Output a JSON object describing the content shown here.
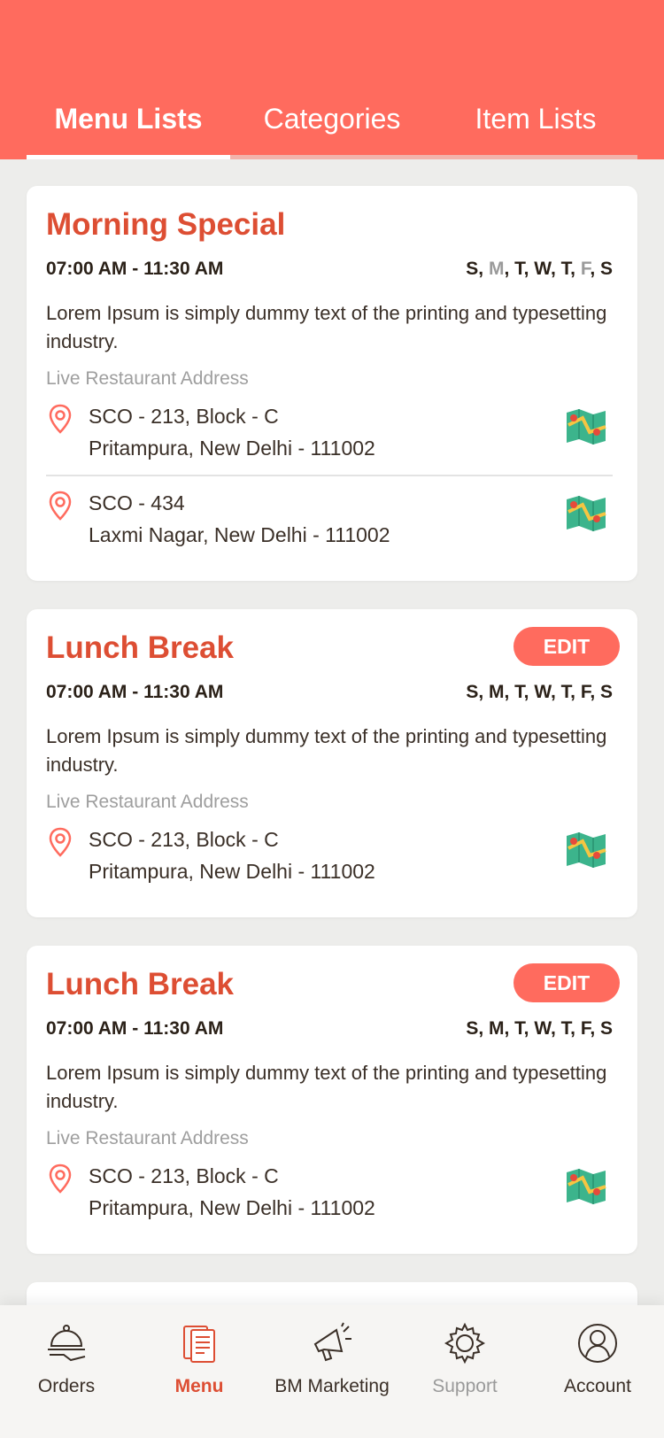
{
  "tabs": [
    {
      "label": "Menu Lists"
    },
    {
      "label": "Categories"
    },
    {
      "label": "Item Lists"
    }
  ],
  "cards": [
    {
      "title": "Morning Special",
      "time": "07:00 AM - 11:30 AM",
      "days": [
        {
          "d": "S",
          "on": true
        },
        {
          "d": "M",
          "on": false
        },
        {
          "d": "T",
          "on": true
        },
        {
          "d": "W",
          "on": true
        },
        {
          "d": "T",
          "on": true
        },
        {
          "d": "F",
          "on": false
        },
        {
          "d": "S",
          "on": true
        }
      ],
      "description": "Lorem Ipsum is simply dummy text of the printing and typesetting industry.",
      "address_label": "Live Restaurant Address",
      "addresses": [
        {
          "line1": "SCO - 213, Block - C",
          "line2": "Pritampura,  New Delhi - 111002"
        },
        {
          "line1": "SCO - 434",
          "line2": "Laxmi Nagar,  New Delhi - 111002"
        }
      ]
    },
    {
      "title": "Lunch Break",
      "edit_label": "EDIT",
      "time": "07:00 AM - 11:30 AM",
      "days_text": "S, M, T,  W, T, F, S",
      "description": "Lorem Ipsum is simply dummy text of the printing and typesetting industry.",
      "address_label": "Live Restaurant Address",
      "addresses": [
        {
          "line1": "SCO - 213, Block - C",
          "line2": "Pritampura,  New Delhi - 111002"
        }
      ]
    },
    {
      "title": "Lunch Break",
      "edit_label": "EDIT",
      "time": "07:00 AM - 11:30 AM",
      "days_text": "S, M, T,  W, T, F, S",
      "description": "Lorem Ipsum is simply dummy text of the printing and typesetting industry.",
      "address_label": "Live Restaurant Address",
      "addresses": [
        {
          "line1": "SCO - 213, Block - C",
          "line2": "Pritampura,  New Delhi - 111002"
        }
      ]
    }
  ],
  "nav": [
    {
      "label": "Orders",
      "icon": "cloche-icon"
    },
    {
      "label": "Menu",
      "icon": "menu-icon"
    },
    {
      "label": "BM Marketing",
      "icon": "megaphone-icon"
    },
    {
      "label": "Support",
      "icon": "gear-icon"
    },
    {
      "label": "Account",
      "icon": "user-icon"
    }
  ],
  "colors": {
    "brand": "#ff6b5e",
    "title": "#dd4e33",
    "inactive_day": "#9a9a9a"
  }
}
